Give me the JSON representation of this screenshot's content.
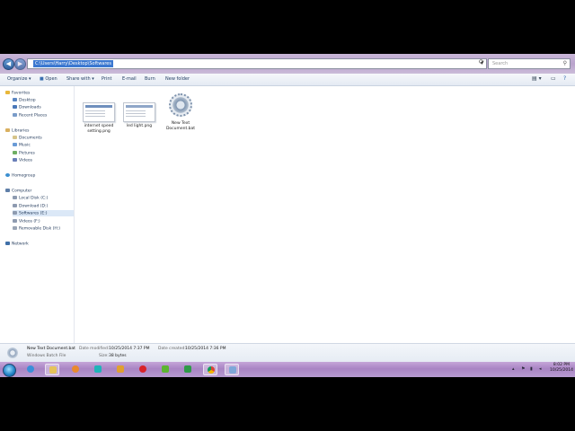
{
  "address": {
    "path": "C:\\Users\\Harry\\Desktop\\Softwares",
    "search_placeholder": "Search"
  },
  "toolbar": {
    "organize": "Organize",
    "open": "Open",
    "share_with": "Share with",
    "print": "Print",
    "email": "E-mail",
    "burn": "Burn",
    "new_folder": "New folder"
  },
  "nav": {
    "favorites": "Favorites",
    "desktop": "Desktop",
    "downloads": "Downloads",
    "recent": "Recent Places",
    "libraries": "Libraries",
    "documents": "Documents",
    "music": "Music",
    "pictures": "Pictures",
    "videos": "Videos",
    "homegroup": "Homegroup",
    "computer": "Computer",
    "local_c": "Local Disk (C:)",
    "download_d": "Download (D:)",
    "softwares_e": "Softwares (E:)",
    "videos_f": "Videos (F:)",
    "removable_h": "Removable Disk (H:)",
    "network": "Network"
  },
  "files": [
    {
      "label": "internet speed\nsetting.png"
    },
    {
      "label": "led light.png"
    },
    {
      "label": "New Text\nDocument.bat"
    }
  ],
  "details": {
    "name": "New Text Document.bat",
    "type": "Windows Batch File",
    "modified_label": "Date modified:",
    "modified_value": "10/25/2014 7:37 PM",
    "created_label": "Date created:",
    "created_value": "10/25/2014 7:36 PM",
    "size_label": "Size:",
    "size_value": "38 bytes"
  },
  "clock": {
    "time": "8:02 PM",
    "date": "10/25/2014"
  },
  "colors": {
    "selection": "#3b78d0",
    "taskbar": "#a985c4"
  }
}
